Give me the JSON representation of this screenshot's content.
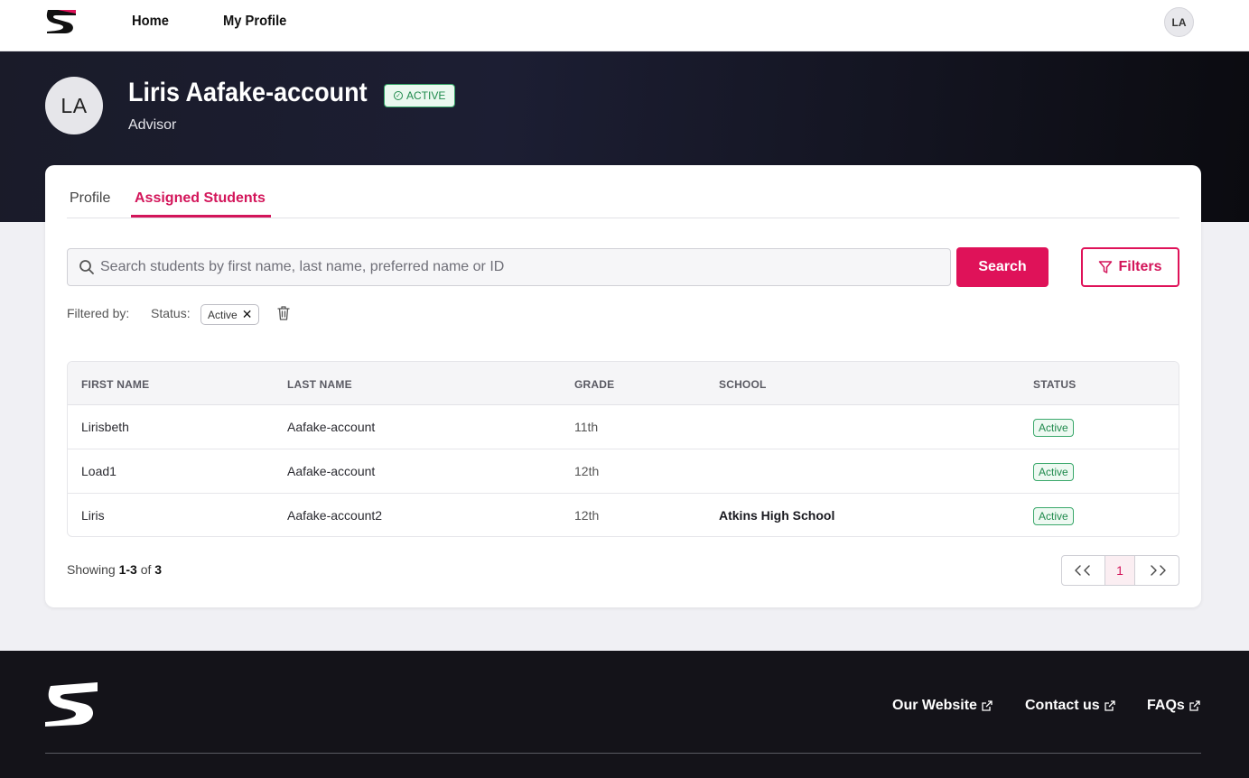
{
  "nav": {
    "home_label": "Home",
    "profile_label": "My Profile",
    "avatar_initials": "LA"
  },
  "hero": {
    "avatar_initials": "LA",
    "name": "Liris Aafake-account",
    "status": "ACTIVE",
    "role": "Advisor"
  },
  "tabs": {
    "profile": "Profile",
    "assigned": "Assigned Students",
    "active_tab": "Assigned Students"
  },
  "search": {
    "placeholder": "Search students by first name, last name, preferred name or ID",
    "value": "",
    "button_label": "Search",
    "filters_label": "Filters"
  },
  "filters": {
    "label": "Filtered by:",
    "status_label": "Status:",
    "status_value": "Active"
  },
  "table": {
    "headers": [
      "FIRST NAME",
      "LAST NAME",
      "GRADE",
      "SCHOOL",
      "STATUS"
    ],
    "rows": [
      {
        "first": "Lirisbeth",
        "last": "Aafake-account",
        "grade": "11th",
        "school": "",
        "status": "Active"
      },
      {
        "first": "Load1",
        "last": "Aafake-account",
        "grade": "12th",
        "school": "",
        "status": "Active"
      },
      {
        "first": "Liris",
        "last": "Aafake-account2",
        "grade": "12th",
        "school": "Atkins High School",
        "status": "Active"
      }
    ]
  },
  "pagination": {
    "showing_prefix": "Showing",
    "range": "1-3",
    "of_label": "of",
    "total": "3",
    "current_page": "1",
    "prev_icon": "double-chevron-left-icon",
    "next_icon": "double-chevron-right-icon"
  },
  "footer": {
    "links": [
      "Our Website",
      "Contact us",
      "FAQs"
    ]
  },
  "colors": {
    "accent": "#df1259",
    "active_green": "#1f8a4c",
    "hero_bg": "#1a1b29",
    "footer_bg": "#141319"
  }
}
